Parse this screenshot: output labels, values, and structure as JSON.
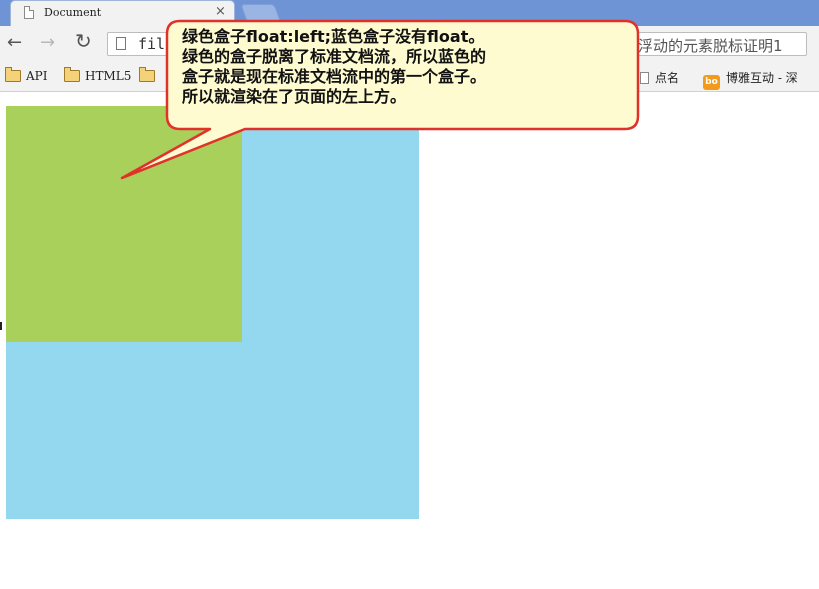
{
  "tab": {
    "title": "Document",
    "close": "×"
  },
  "toolbar": {
    "back": "←",
    "forward": "→",
    "reload": "↻",
    "url_text": "fil",
    "page_title_partial": "浮动的元素脱标证明1"
  },
  "bookmarks": [
    {
      "label": "API",
      "icon": "folder-icon"
    },
    {
      "label": "HTML5",
      "icon": "folder-icon"
    },
    {
      "label": "",
      "icon": "folder-icon"
    },
    {
      "label": "点名",
      "icon": "page-icon"
    },
    {
      "label": "博雅互动 - 深",
      "icon": "bo-icon",
      "badge": "bo"
    }
  ],
  "callout": {
    "lines": [
      "绿色盒子float:left;蓝色盒子没有float。",
      "绿色的盒子脱离了标准文档流，所以蓝色的",
      "盒子就是现在标准文档流中的第一个盒子。",
      "所以就渲染在了页面的左上方。"
    ]
  },
  "colors": {
    "green_box": "#a8d05a",
    "blue_box": "#94d8ef",
    "callout_fill": "#fffbd0",
    "callout_border": "#e0312a"
  }
}
